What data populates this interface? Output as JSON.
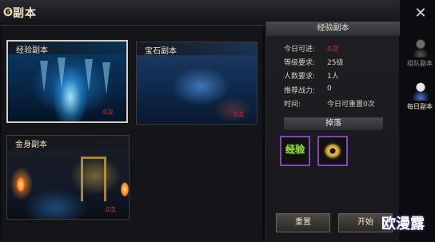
{
  "window": {
    "title": "副本",
    "title_icon": "swirl-icon",
    "close_icon": "close-icon"
  },
  "dungeons": [
    {
      "label": "经验副本",
      "count_text": "0次",
      "selected": true
    },
    {
      "label": "宝石副本",
      "count_text": "0次",
      "selected": false
    },
    {
      "label": "金身副本",
      "count_text": "0次",
      "selected": false
    }
  ],
  "detail": {
    "header": "经验副本",
    "rows": [
      {
        "label": "今日可进:",
        "value": "0次",
        "highlight": true
      },
      {
        "label": "等级要求:",
        "value": "25级"
      },
      {
        "label": "人数要求:",
        "value": "1人"
      },
      {
        "label": "推荐战力:",
        "value": "0"
      },
      {
        "label": "时间:",
        "value": "今日可重置0次"
      }
    ],
    "drop_header": "掉落",
    "drops": [
      {
        "icon": "exp-scroll-icon",
        "text": "经验"
      },
      {
        "icon": "gold-coin-icon"
      }
    ],
    "buttons": {
      "reset": "重置",
      "start": "开始"
    }
  },
  "side_tabs": [
    {
      "label": "组队副本",
      "icon": "team-dungeon-icon",
      "active": false
    },
    {
      "label": "每日副本",
      "icon": "daily-dungeon-icon",
      "active": true
    }
  ],
  "watermark": "欧漫露",
  "colors": {
    "count_red": "#d0342c",
    "drop_border": "#8a40b8",
    "exp_green": "#9ee04a",
    "coin_gold": "#f0c24a"
  }
}
